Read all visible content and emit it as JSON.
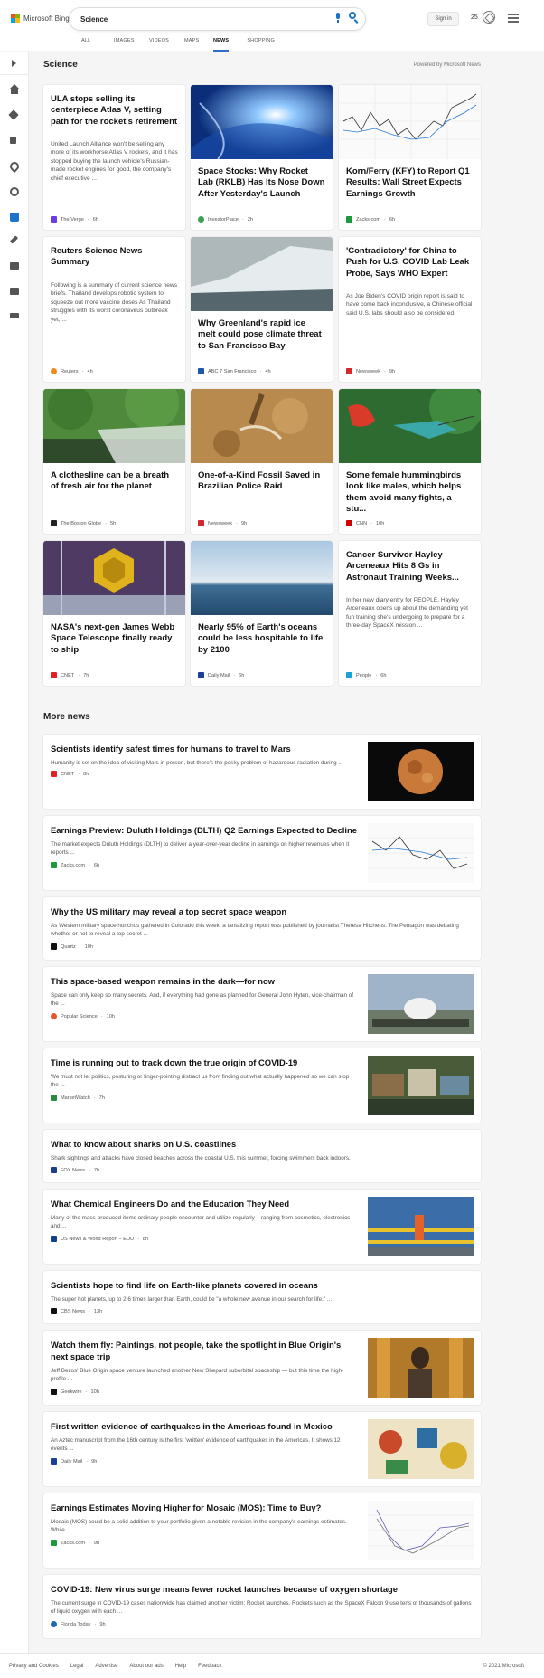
{
  "header": {
    "brand": "Microsoft Bing",
    "search_value": "Science",
    "signin_label": "Sign in",
    "rewards_count": "25",
    "tabs": [
      "ALL",
      "IMAGES",
      "VIDEOS",
      "MAPS",
      "NEWS",
      "SHOPPING"
    ],
    "active_tab": "NEWS"
  },
  "sidebar": {
    "icons": [
      "expand-icon",
      "home-icon",
      "tools-icon",
      "flag-icon",
      "location-pin-icon",
      "globe-icon",
      "science-icon",
      "rocket-icon",
      "film-icon",
      "bank-icon",
      "tv-icon"
    ]
  },
  "science": {
    "title": "Science",
    "powered_by": "Powered by Microsoft News",
    "cards": [
      {
        "title": "ULA stops selling its centerpiece Atlas V, setting path for the rocket's retirement",
        "desc": "United Launch Alliance won't be selling any more of its workhorse Atlas V rockets, and it has stopped buying the launch vehicle's Russian-made rocket engines for good, the company's chief executive ...",
        "source": "The Verge",
        "time": "6h"
      },
      {
        "title": "Space Stocks: Why Rocket Lab (RKLB) Has Its Nose Down After Yesterday's Launch",
        "source": "InvestorPlace",
        "time": "2h"
      },
      {
        "title": "Korn/Ferry (KFY) to Report Q1 Results: Wall Street Expects Earnings Growth",
        "source": "Zacks.com",
        "time": "6h"
      },
      {
        "title": "Reuters Science News Summary",
        "desc": "Following is a summary of current science news briefs. Thailand develops robotic system to squeeze out more vaccine doses As Thailand struggles with its worst coronavirus outbreak yet, ...",
        "source": "Reuters",
        "time": "4h"
      },
      {
        "title": "Why Greenland's rapid ice melt could pose climate threat to San Francisco Bay",
        "source": "ABC 7 San Francisco",
        "time": "4h"
      },
      {
        "title": "'Contradictory' for China to Push for U.S. COVID Lab Leak Probe, Says WHO Expert",
        "desc": "As Joe Biden's COVID origin report is said to have come back inconclusive, a Chinese official said U.S. labs should also be considered.",
        "source": "Newsweek",
        "time": "9h"
      },
      {
        "title": "A clothesline can be a breath of fresh air for the planet",
        "source": "The Boston Globe",
        "time": "5h"
      },
      {
        "title": "One-of-a-Kind Fossil Saved in Brazilian Police Raid",
        "source": "Newsweek",
        "time": "9h"
      },
      {
        "title": "Some female hummingbirds look like males, which helps them avoid many fights, a stu...",
        "source": "CNN",
        "time": "10h"
      },
      {
        "title": "NASA's next-gen James Webb Space Telescope finally ready to ship",
        "source": "CNET",
        "time": "7h"
      },
      {
        "title": "Nearly 95% of Earth's oceans could be less hospitable to life by 2100",
        "source": "Daily Mail",
        "time": "6h"
      },
      {
        "title": "Cancer Survivor Hayley Arceneaux Hits 8 Gs in Astronaut Training Weeks...",
        "desc": "In her new diary entry for PEOPLE, Hayley Arceneaux opens up about the demanding yet fun training she's undergoing to prepare for a three-day SpaceX mission ...",
        "source": "People",
        "time": "6h"
      }
    ]
  },
  "more_news": {
    "title": "More news",
    "items": [
      {
        "title": "Scientists identify safest times for humans to travel to Mars",
        "desc": "Humanity is set on the idea of visiting Mars in person, but there's the pesky problem of hazardous radiation during ...",
        "source": "CNET",
        "time": "8h"
      },
      {
        "title": "Earnings Preview: Duluth Holdings (DLTH) Q2 Earnings Expected to Decline",
        "desc": "The market expects Duluth Holdings (DLTH) to deliver a year-over-year decline in earnings on higher revenues when it reports ...",
        "source": "Zacks.com",
        "time": "6h"
      },
      {
        "title": "Why the US military may reveal a top secret space weapon",
        "desc": "As Western military space honchos gathered in Colorado this week, a tantalizing report was published by journalist Theresa Hitchens: The Pentagon was debating whether or not to reveal a top secret ...",
        "source": "Quartz",
        "time": "10h"
      },
      {
        "title": "This space-based weapon remains in the dark—for now",
        "desc": "Space can only keep so many secrets. And, if everything had gone as planned for General John Hyten, vice-chairman of the ...",
        "source": "Popular Science",
        "time": "10h"
      },
      {
        "title": "Time is running out to track down the true origin of COVID-19",
        "desc": "We must not let politics, posturing or finger-pointing distract us from finding out what actually happened so we can stop the ...",
        "source": "MarketWatch",
        "time": "7h"
      },
      {
        "title": "What to know about sharks on U.S. coastlines",
        "desc": "Shark sightings and attacks have closed beaches across the coastal U.S. this summer, forcing swimmers back indoors.",
        "source": "FOX News",
        "time": "7h"
      },
      {
        "title": "What Chemical Engineers Do and the Education They Need",
        "desc": "Many of the mass-produced items ordinary people encounter and utilize regularly – ranging from cosmetics, electronics and ...",
        "source": "US News & World Report – EDU",
        "time": "8h"
      },
      {
        "title": "Scientists hope to find life on Earth-like planets covered in oceans",
        "desc": "The super hot planets, up to 2.6 times larger than Earth, could be \"a whole new avenue in our search for life.\" ...",
        "source": "CBS News",
        "time": "13h"
      },
      {
        "title": "Watch them fly: Paintings, not people, take the spotlight in Blue Origin's next space trip",
        "desc": "Jeff Bezos' Blue Origin space venture launched another New Shepard suborbital spaceship — but this time the high-profile ...",
        "source": "Geekwire",
        "time": "10h"
      },
      {
        "title": "First written evidence of earthquakes in the Americas found in Mexico",
        "desc": "An Aztec manuscript from the 16th century is the first 'written' evidence of earthquakes in the Americas. It shows 12 events ...",
        "source": "Daily Mail",
        "time": "9h"
      },
      {
        "title": "Earnings Estimates Moving Higher for Mosaic (MOS): Time to Buy?",
        "desc": "Mosaic (MOS) could be a solid addition to your portfolio given a notable revision in the company's earnings estimates. While ...",
        "source": "Zacks.com",
        "time": "9h"
      },
      {
        "title": "COVID-19: New virus surge means fewer rocket launches because of oxygen shortage",
        "desc": "The current surge in COVID-19 cases nationwide has claimed another victim: Rocket launches. Rockets such as the SpaceX Falcon 9 use tens of thousands of gallons of liquid oxygen with each ...",
        "source": "Florida Today",
        "time": "9h"
      }
    ]
  },
  "footer": {
    "links": [
      "Privacy and Cookies",
      "Legal",
      "Advertise",
      "About our ads",
      "Help",
      "Feedback"
    ],
    "copyright": "© 2021 Microsoft"
  }
}
